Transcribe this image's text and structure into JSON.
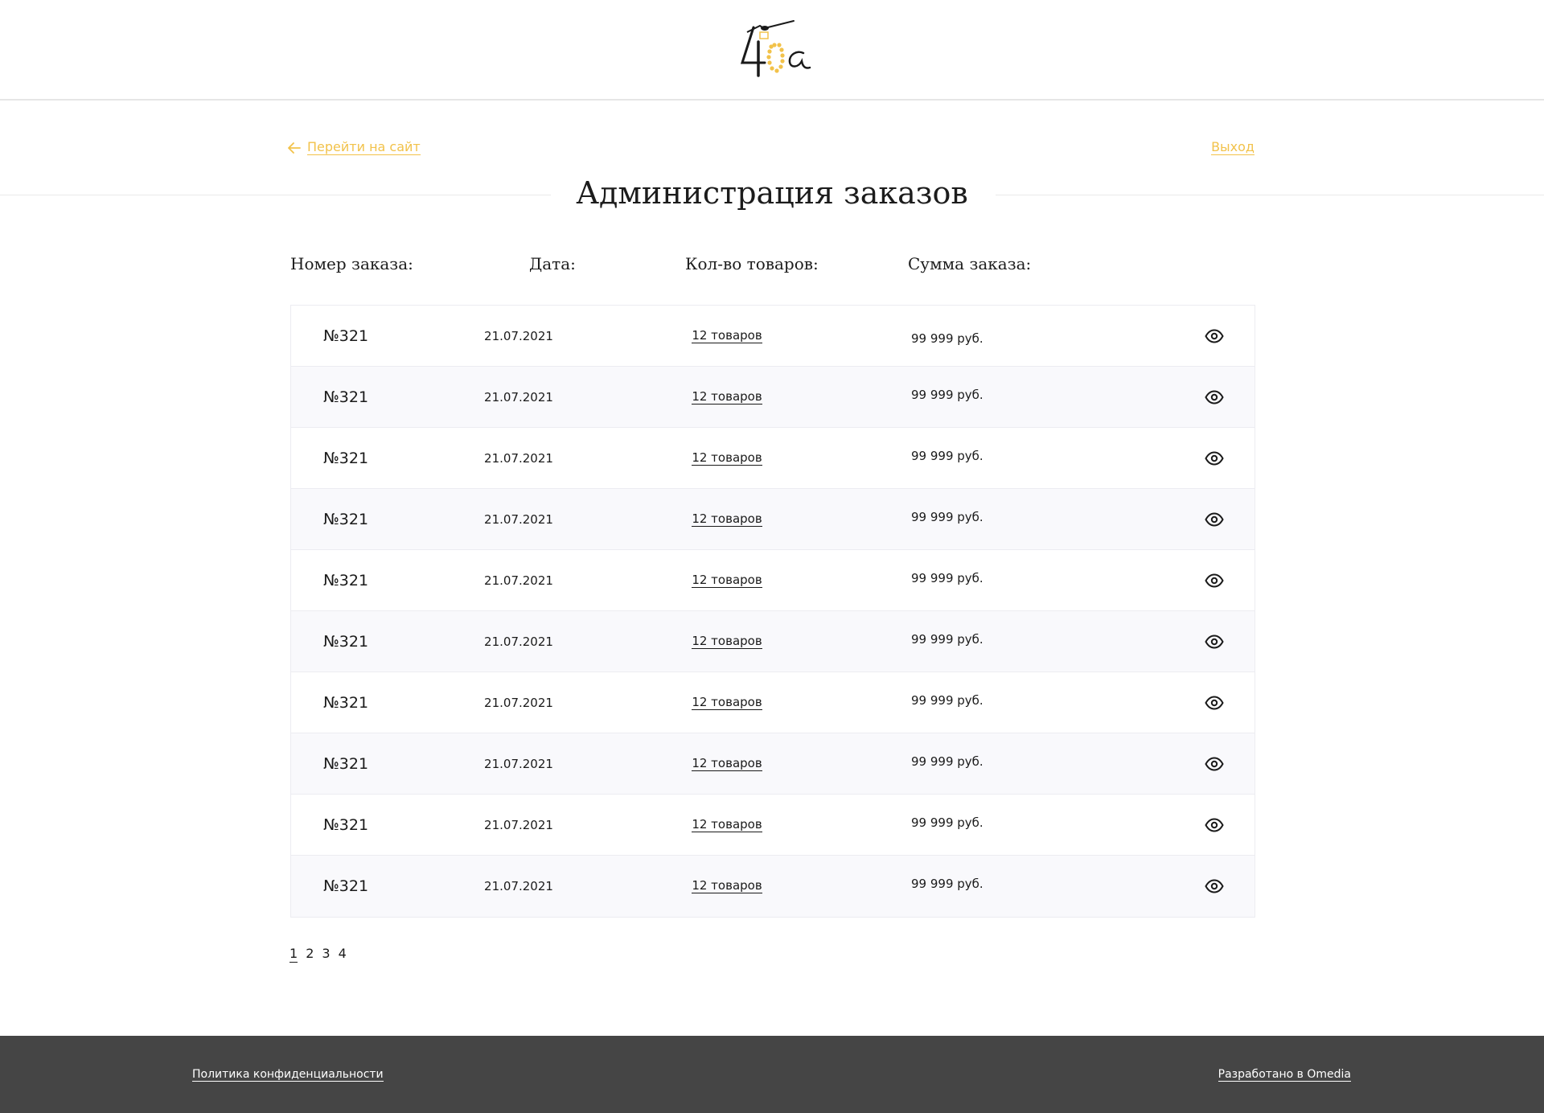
{
  "header": {
    "logo_text": "40a",
    "logo_accent_color": "#f2c24a"
  },
  "nav": {
    "back_label": "Перейти на сайт",
    "exit_label": "Выход"
  },
  "page": {
    "title": "Администрация заказов"
  },
  "table": {
    "columns": [
      "Номер заказа:",
      "Дата:",
      "Кол-во товаров:",
      "Сумма заказа:"
    ],
    "rows": [
      {
        "number": "№321",
        "date": "21.07.2021",
        "qty": "12 товаров",
        "sum": "99 999 руб."
      },
      {
        "number": "№321",
        "date": "21.07.2021",
        "qty": "12 товаров",
        "sum": "99 999 руб."
      },
      {
        "number": "№321",
        "date": "21.07.2021",
        "qty": "12 товаров",
        "sum": "99 999 руб."
      },
      {
        "number": "№321",
        "date": "21.07.2021",
        "qty": "12 товаров",
        "sum": "99 999 руб."
      },
      {
        "number": "№321",
        "date": "21.07.2021",
        "qty": "12 товаров",
        "sum": "99 999 руб."
      },
      {
        "number": "№321",
        "date": "21.07.2021",
        "qty": "12 товаров",
        "sum": "99 999 руб."
      },
      {
        "number": "№321",
        "date": "21.07.2021",
        "qty": "12 товаров",
        "sum": "99 999 руб."
      },
      {
        "number": "№321",
        "date": "21.07.2021",
        "qty": "12 товаров",
        "sum": "99 999 руб."
      },
      {
        "number": "№321",
        "date": "21.07.2021",
        "qty": "12 товаров",
        "sum": "99 999 руб."
      },
      {
        "number": "№321",
        "date": "21.07.2021",
        "qty": "12 товаров",
        "sum": "99 999 руб."
      }
    ],
    "row_action_icon": "eye-icon"
  },
  "pagination": {
    "pages": [
      "1",
      "2",
      "3",
      "4"
    ],
    "current": "1"
  },
  "footer": {
    "privacy_label": "Политика конфиденциальности",
    "developer_label": "Разработано в Omedia"
  },
  "colors": {
    "accent": "#f2c24a",
    "footer_bg": "#454545",
    "row_alt_bg": "#f9f9fc"
  }
}
